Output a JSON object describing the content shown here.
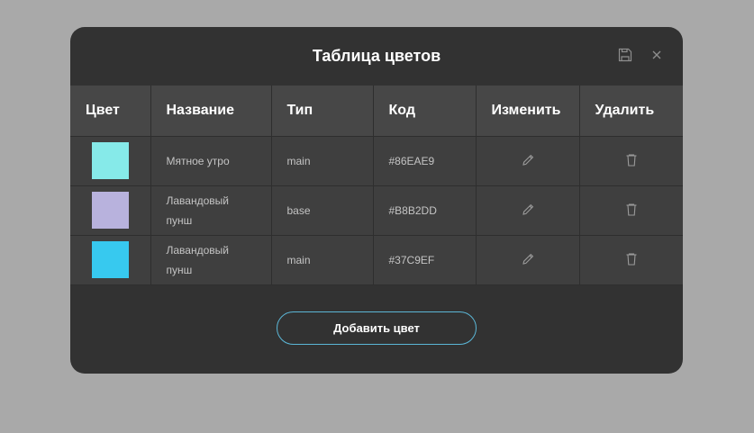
{
  "modal": {
    "title": "Таблица цветов",
    "icons": {
      "save": "save-icon",
      "close": "close-icon"
    }
  },
  "table": {
    "headers": [
      "Цвет",
      "Название",
      "Тип",
      "Код",
      "Изменить",
      "Удалить"
    ],
    "rows": [
      {
        "color": "#86EAE9",
        "name": "Мятное утро",
        "type": "main",
        "code": "#86EAE9",
        "edit_icon": "pencil-icon",
        "delete_icon": "trash-icon"
      },
      {
        "color": "#B8B2DD",
        "name": "Лавандовый пунш",
        "type": "base",
        "code": "#B8B2DD",
        "edit_icon": "pencil-icon",
        "delete_icon": "trash-icon"
      },
      {
        "color": "#37C9EF",
        "name": "Лавандовый пунш",
        "type": "main",
        "code": "#37C9EF",
        "edit_icon": "pencil-icon",
        "delete_icon": "trash-icon"
      }
    ]
  },
  "footer": {
    "add_button_label": "Добавить цвет"
  },
  "theme": {
    "backdrop": "#a9a9a9",
    "modal_bg": "#323232",
    "header_row_bg": "#474747",
    "body_row_bg": "#3f3f3f",
    "accent_border": "#5bb6d6"
  }
}
